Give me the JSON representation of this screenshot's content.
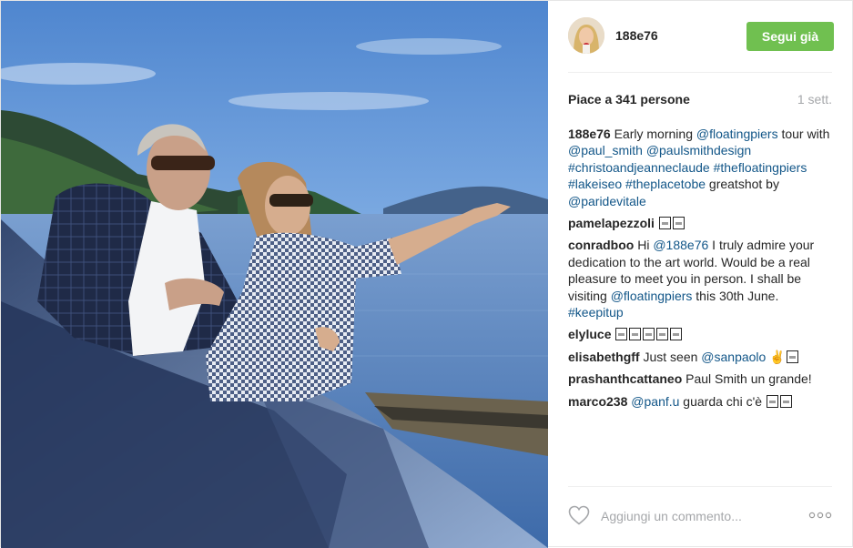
{
  "post": {
    "author": "188e76",
    "follow_label": "Segui già",
    "likes_text": "Piace a 341 persone",
    "time_ago": "1 sett.",
    "comment_placeholder": "Aggiungi un commento...",
    "more_icon": "ellipsis-icon",
    "like_icon": "heart-outline-icon",
    "colors": {
      "follow": "#70c050",
      "mention": "#125688",
      "muted": "#a5a7aa"
    }
  },
  "caption": {
    "user": "188e76",
    "t1": " Early morning ",
    "m1": "@floatingpiers",
    "t2": " tour with ",
    "m2": "@paul_smith",
    "t3": " ",
    "m3": "@paulsmithdesign",
    "t4": " ",
    "h1": "#christoandjeanneclaude",
    "t5": " ",
    "h2": "#thefloatingpiers",
    "t6": " ",
    "h3": "#lakeiseo",
    "t7": " ",
    "h4": "#theplacetobe",
    "t8": " greatshot by ",
    "m4": "@paridevitale"
  },
  "comments": [
    {
      "user": "pamelapezzoli"
    },
    {
      "user": "conradboo",
      "t1": " Hi ",
      "m1": "@188e76",
      "t2": " I truly admire your dedication to the art world. Would be a real pleasure to meet you in person. I shall be visiting ",
      "m2": "@floatingpiers",
      "t3": " this 30th June. ",
      "h1": "#keepitup"
    },
    {
      "user": "elyluce"
    },
    {
      "user": "elisabethgff",
      "t1": " Just seen ",
      "m1": "@sanpaolo",
      "t2": " ✌"
    },
    {
      "user": "prashanthcattaneo",
      "t1": " Paul Smith un grande!"
    },
    {
      "user": "marco238",
      "m1": "@panf.u",
      "t1": " guarda chi c'è "
    }
  ]
}
